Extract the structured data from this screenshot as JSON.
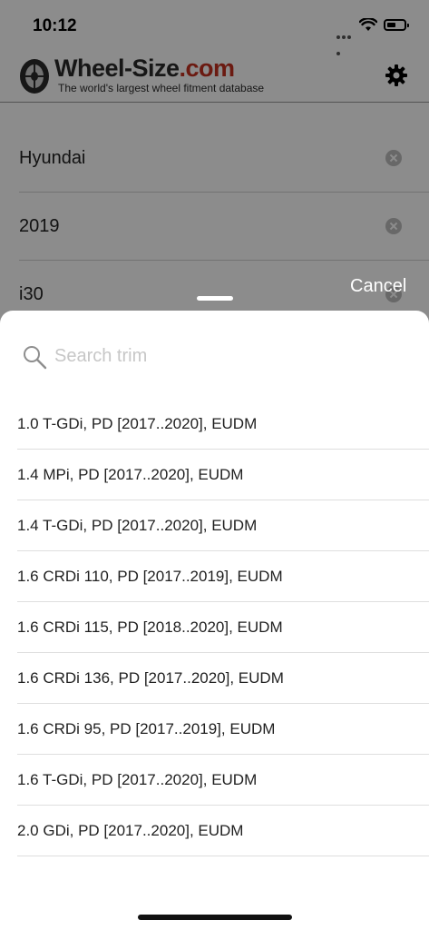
{
  "status_bar": {
    "time": "10:12"
  },
  "header": {
    "logo_name": "Wheel-Size",
    "logo_domain": ".com",
    "logo_tagline": "The world's largest wheel fitment database"
  },
  "fields": [
    {
      "value": "Hyundai"
    },
    {
      "value": "2019"
    },
    {
      "value": "i30"
    }
  ],
  "sheet": {
    "cancel_label": "Cancel",
    "search_placeholder": "Search trim",
    "trims": [
      "1.0 T-GDi, PD [2017..2020], EUDM",
      "1.4 MPi, PD [2017..2020], EUDM",
      "1.4 T-GDi, PD [2017..2020], EUDM",
      "1.6 CRDi 110, PD [2017..2019], EUDM",
      "1.6 CRDi 115, PD [2018..2020], EUDM",
      "1.6 CRDi 136, PD [2017..2020], EUDM",
      "1.6 CRDi 95, PD [2017..2019], EUDM",
      "1.6 T-GDi, PD [2017..2020], EUDM",
      "2.0 GDi, PD [2017..2020], EUDM"
    ]
  },
  "colors": {
    "brand_red": "#c4301f",
    "dim_overlay": "rgba(0,0,0,0.45)"
  }
}
